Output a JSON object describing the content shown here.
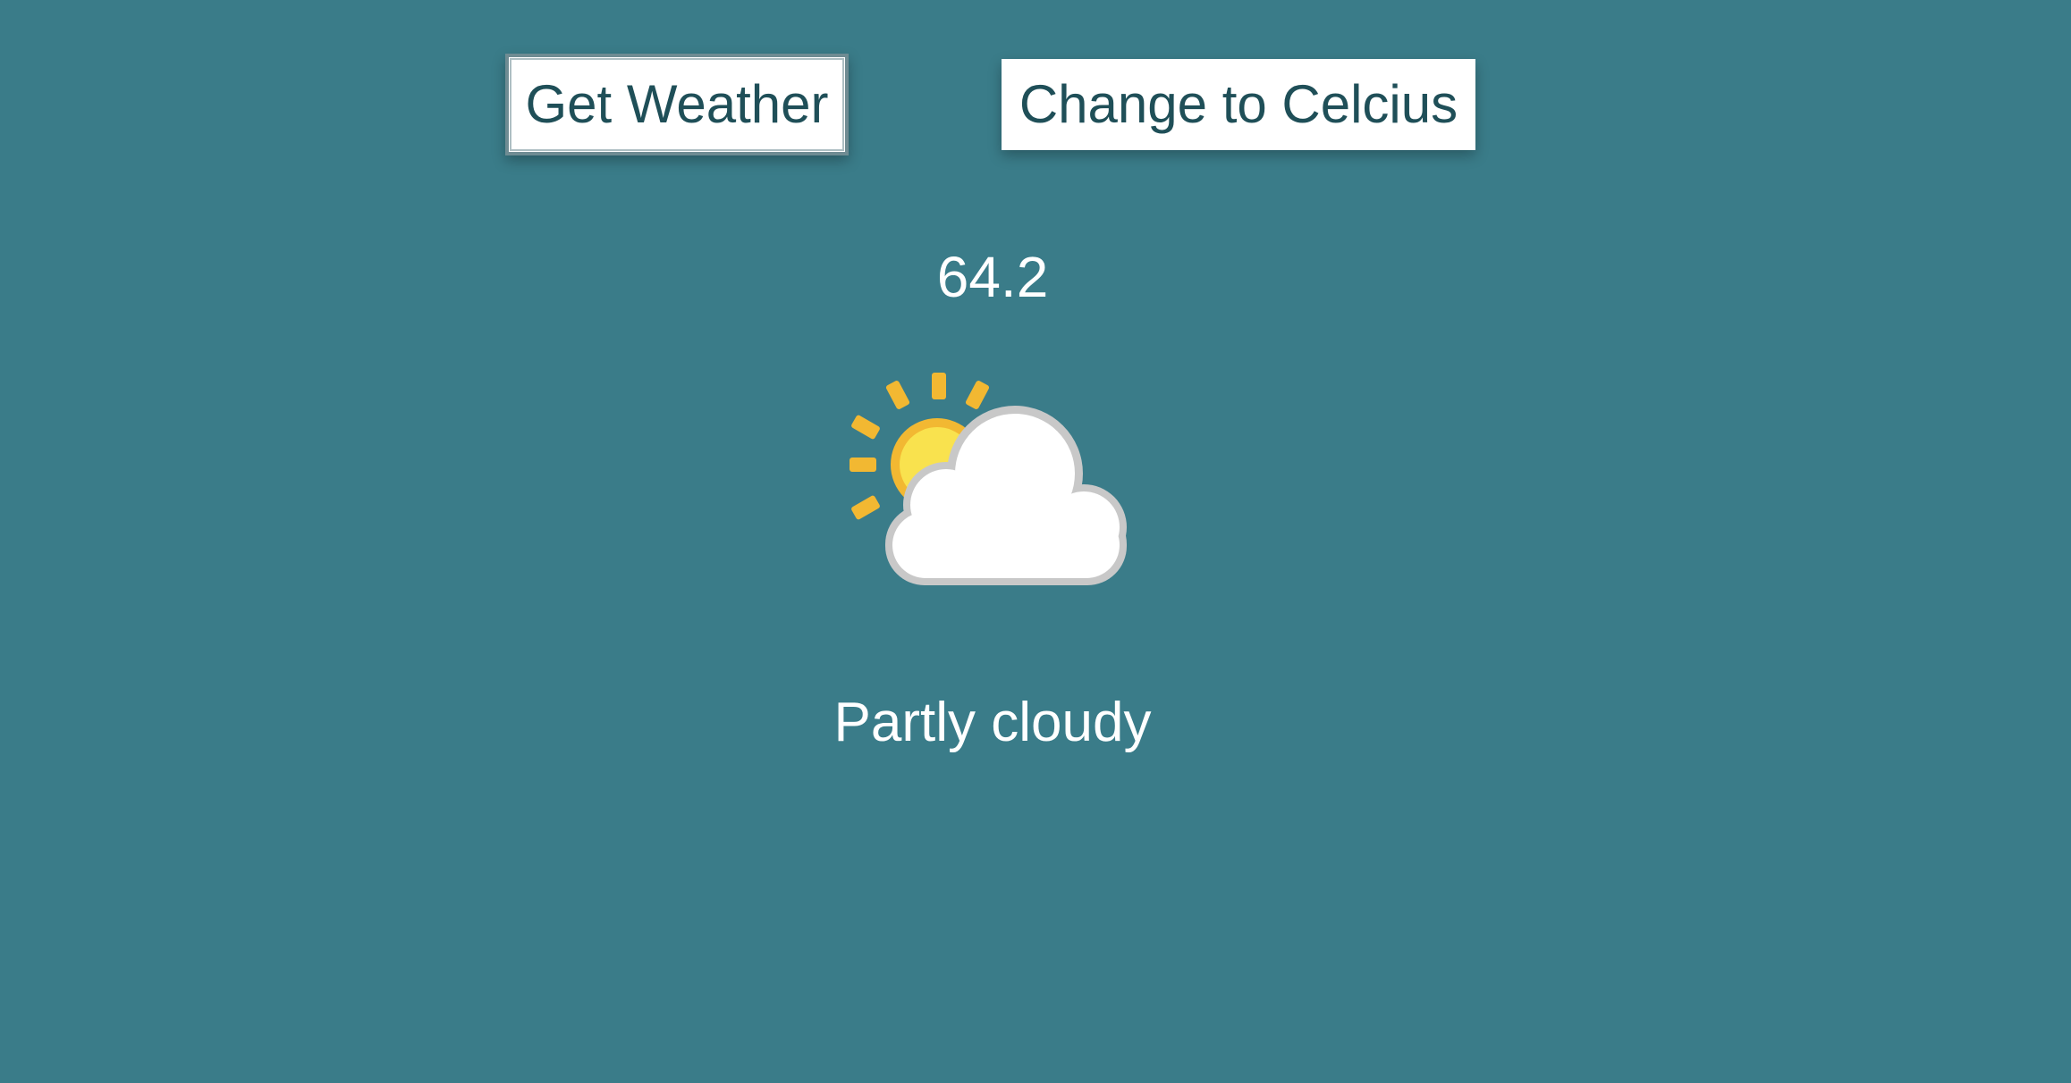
{
  "controls": {
    "get_weather_label": "Get Weather",
    "unit_toggle_label": "Change to Celcius"
  },
  "weather": {
    "temperature": "64.2",
    "condition": "Partly cloudy",
    "icon": "partly-cloudy-icon"
  },
  "colors": {
    "background": "#3a7c89",
    "button_text": "#1f4f58",
    "sun": "#f7d63c",
    "sun_rays": "#f2b832",
    "cloud": "#ffffff",
    "cloud_outline": "#c8c8c8"
  }
}
